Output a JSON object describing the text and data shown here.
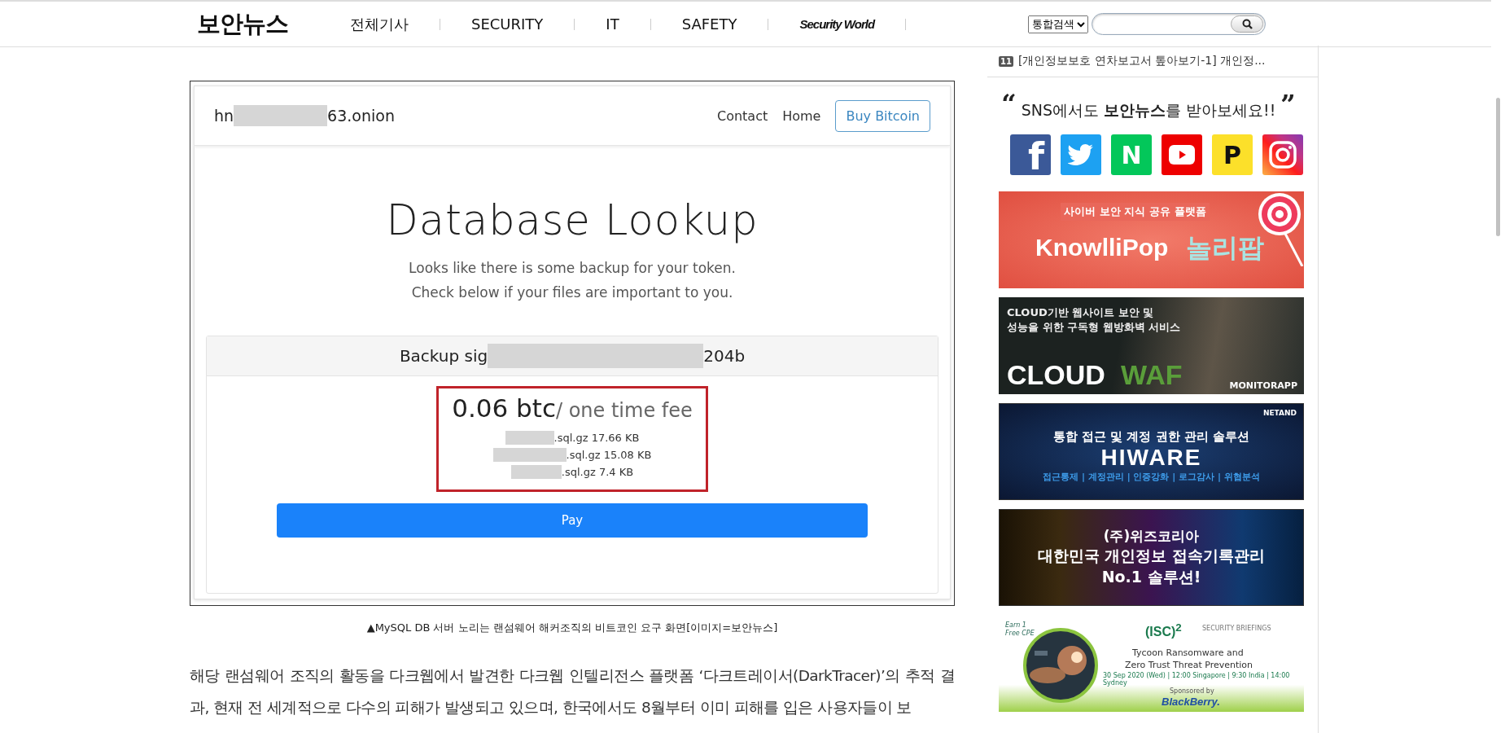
{
  "header": {
    "logo": "보안뉴스",
    "nav": [
      {
        "label": "전체기사",
        "kind": "text"
      },
      {
        "label": "SECURITY",
        "kind": "text"
      },
      {
        "label": "IT",
        "kind": "text"
      },
      {
        "label": "SAFETY",
        "kind": "text"
      },
      {
        "label": "Security World",
        "kind": "script"
      }
    ],
    "search": {
      "scope": "통합검색"
    }
  },
  "article": {
    "screenshot": {
      "host_start": "hn",
      "host_end": "63.onion",
      "nav": [
        "Contact",
        "Home"
      ],
      "button": "Buy Bitcoin",
      "title": "Database Lookup",
      "subtitle": [
        "Looks like there is some backup for your token.",
        "Check below if your files are important to you."
      ],
      "signature_start": "Backup sig",
      "signature_end": "204b",
      "price": "0.06 btc",
      "price_unit": "/ one time fee",
      "files": [
        ".sql.gz 17.66 KB",
        ".sql.gz 15.08 KB",
        ".sql.gz 7.4 KB"
      ],
      "pay": "Pay"
    },
    "caption": "▲MySQL DB 서버 노리는 랜섬웨어 해커조직의 비트코인 요구 화면[이미지=보안뉴스]",
    "paragraph": "해당 랜섬웨어 조직의 활동을 다크웹에서 발견한 다크웹 인텔리전스 플랫폼 ‘다크트레이서(DarkTracer)’의 추적 결과, 현재 전 세계적으로 다수의 피해가 발생되고 있으며, 한국에서도 8월부터 이미 피해를 입은 사용자들이 보"
  },
  "sidebar": {
    "headline": {
      "badge": "11",
      "text": "[개인정보보호 연차보고서 톺아보기-1] 개인정..."
    },
    "sns_title": {
      "open_quote": "“",
      "text": "SNS에서도 **보안뉴스**를 받아보세요!!",
      "close_quote": "”"
    },
    "sns": [
      {
        "kind": "facebook",
        "glyph": "f"
      },
      {
        "kind": "twitter"
      },
      {
        "kind": "naver",
        "glyph": "N"
      },
      {
        "kind": "youtube"
      },
      {
        "kind": "post",
        "glyph": "P"
      },
      {
        "kind": "instagram"
      }
    ],
    "banners": [
      {
        "kind": "knowllipop",
        "lines": [
          "사이버 보안 지식 공유 플랫폼",
          "KnowlliPop",
          "놀리팝"
        ]
      },
      {
        "kind": "cloudwaf",
        "lines": [
          "CLOUD기반 웹사이트 보안 및",
          "성능을 위한 **구독형 웹방화벽** 서비스",
          "CLOUD",
          "WAF",
          "MONITORAPP"
        ]
      },
      {
        "kind": "hiware",
        "lines": [
          "NETAND",
          "통합 접근 및 계정 권한 관리 솔루션",
          "HIWARE",
          "접근통제 | 계정관리 | 인증강화 | 로그감사 | 위협분석"
        ]
      },
      {
        "kind": "wiz",
        "lines": [
          "(주)위즈코리아",
          "대한민국 개인정보 접속기록관리",
          "No.1 솔루션!"
        ]
      },
      {
        "kind": "isc",
        "lines": [
          "Earn 1 Free CPE",
          "(ISC)$^{2}$",
          "SECURITY BRIEFINGS",
          "Tycoon Ransomware and",
          "Zero Trust Threat Prevention",
          "30 Sep 2020 (Wed) | 12:00 Singapore | 9:30 India | 14:00 Sydney",
          "Sponsored by",
          "BlackBerry."
        ]
      }
    ]
  }
}
